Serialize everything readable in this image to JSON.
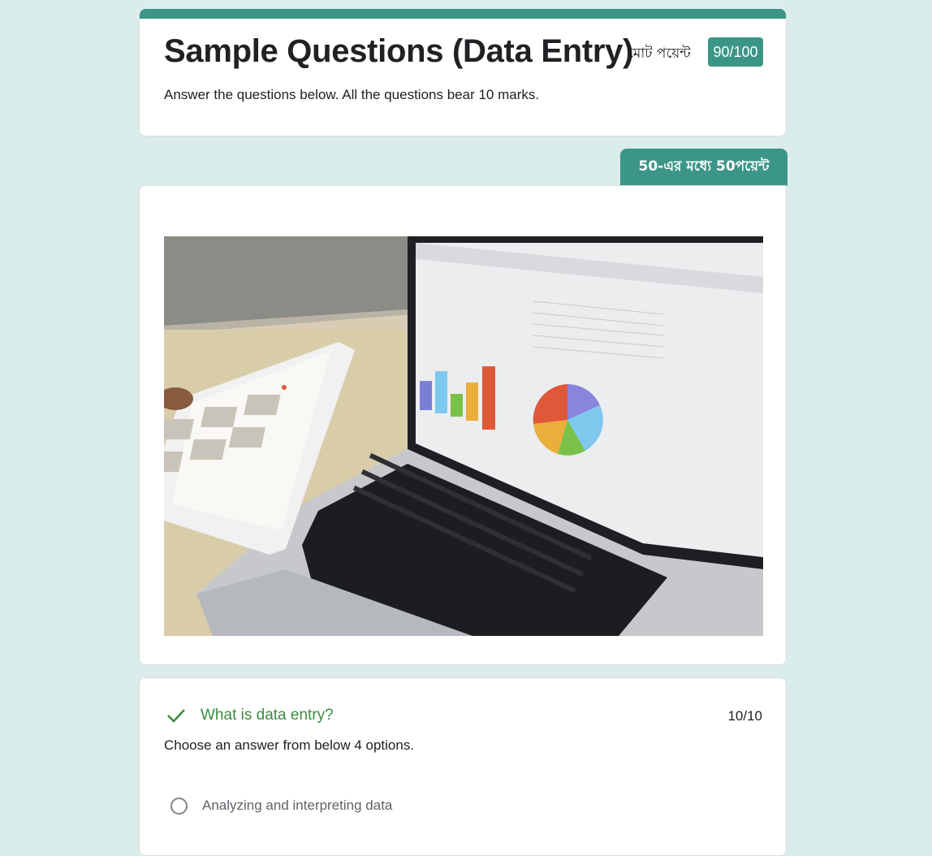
{
  "header": {
    "title": "Sample Questions (Data Entry)",
    "total_points_label": "মোট পয়েন্ট",
    "total_points": "90/100",
    "description": "Answer the questions below. All the questions bear 10 marks."
  },
  "section": {
    "score_label": "50-এর মধ্যে 50পয়েন্ট"
  },
  "question": {
    "title": "What is data entry?",
    "points": "10/10",
    "description": "Choose an answer from below 4 options.",
    "options": [
      {
        "label": "Analyzing and interpreting data"
      }
    ]
  },
  "colors": {
    "accent": "#3c9687",
    "background": "#dbedeb",
    "correct": "#3d8c40"
  },
  "icons": {
    "correct": "check-icon",
    "option": "radio-unchecked-icon"
  }
}
